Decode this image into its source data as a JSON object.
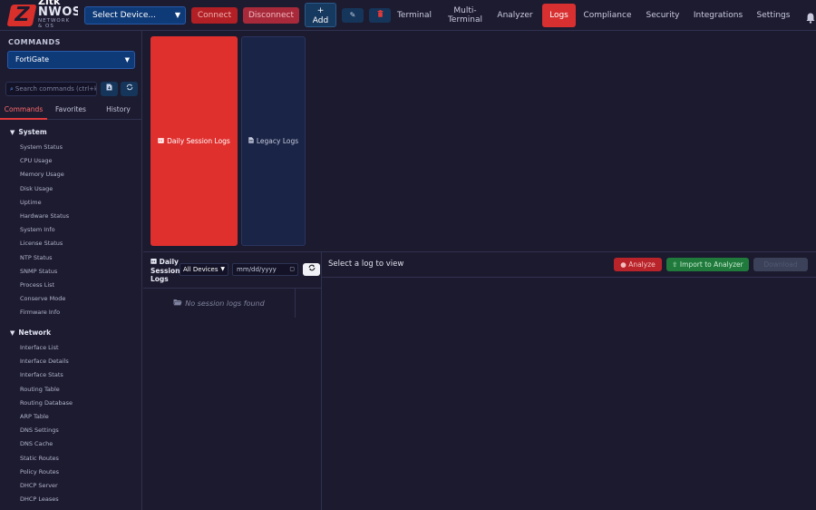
{
  "app": {
    "logo_top": "Zitk",
    "logo_brand": "NWOS",
    "logo_sub1": "NETWORK",
    "logo_sub2": "& OS"
  },
  "toolbar": {
    "device_select": "Select Device...",
    "connect_label": "Connect",
    "disconnect_label": "Disconnect",
    "add_icon": "+",
    "add_label": "Add",
    "edit_icon": "✎",
    "delete_icon": "🗑"
  },
  "nav": {
    "terminal": "Terminal",
    "multi_terminal_1": "Multi-",
    "multi_terminal_2": "Terminal",
    "analyzer": "Analyzer",
    "logs": "Logs",
    "compliance": "Compliance",
    "security": "Security",
    "integrations": "Integrations",
    "settings": "Settings",
    "active": "Logs"
  },
  "sidebar": {
    "heading": "COMMANDS",
    "platform": "FortiGate",
    "search_placeholder": "Search commands (ctrl+k)",
    "tabs": [
      "Commands",
      "Favorites",
      "History"
    ],
    "groups": [
      {
        "label": "System",
        "items": [
          "System Status",
          "CPU Usage",
          "Memory Usage",
          "Disk Usage",
          "Uptime",
          "Hardware Status",
          "System Info",
          "License Status",
          "NTP Status",
          "SNMP Status",
          "Process List",
          "Conserve Mode",
          "Firmware Info"
        ]
      },
      {
        "label": "Network",
        "items": [
          "Interface List",
          "Interface Details",
          "Interface Stats",
          "Routing Table",
          "Routing Database",
          "ARP Table",
          "DNS Settings",
          "DNS Cache",
          "Static Routes",
          "Policy Routes",
          "DHCP Server",
          "DHCP Leases"
        ]
      }
    ]
  },
  "logs": {
    "daily_card": "Daily Session Logs",
    "legacy_card": "Legacy Logs",
    "panel_title_1": "Daily",
    "panel_title_2": "Session",
    "panel_title_3": "Logs",
    "filter_value": "All Devices",
    "date_placeholder": "mm/dd/yyyy",
    "empty_text": "No session logs found",
    "viewer_title": "Select a log to view",
    "analyze_label": "Analyze",
    "import_label": "Import to Analyzer",
    "download_label": "Download"
  },
  "colors": {
    "accent_red": "#e0302e",
    "primary_blue": "#0f3a78",
    "success_green": "#1f7a3c",
    "background": "#1c1a2e"
  }
}
